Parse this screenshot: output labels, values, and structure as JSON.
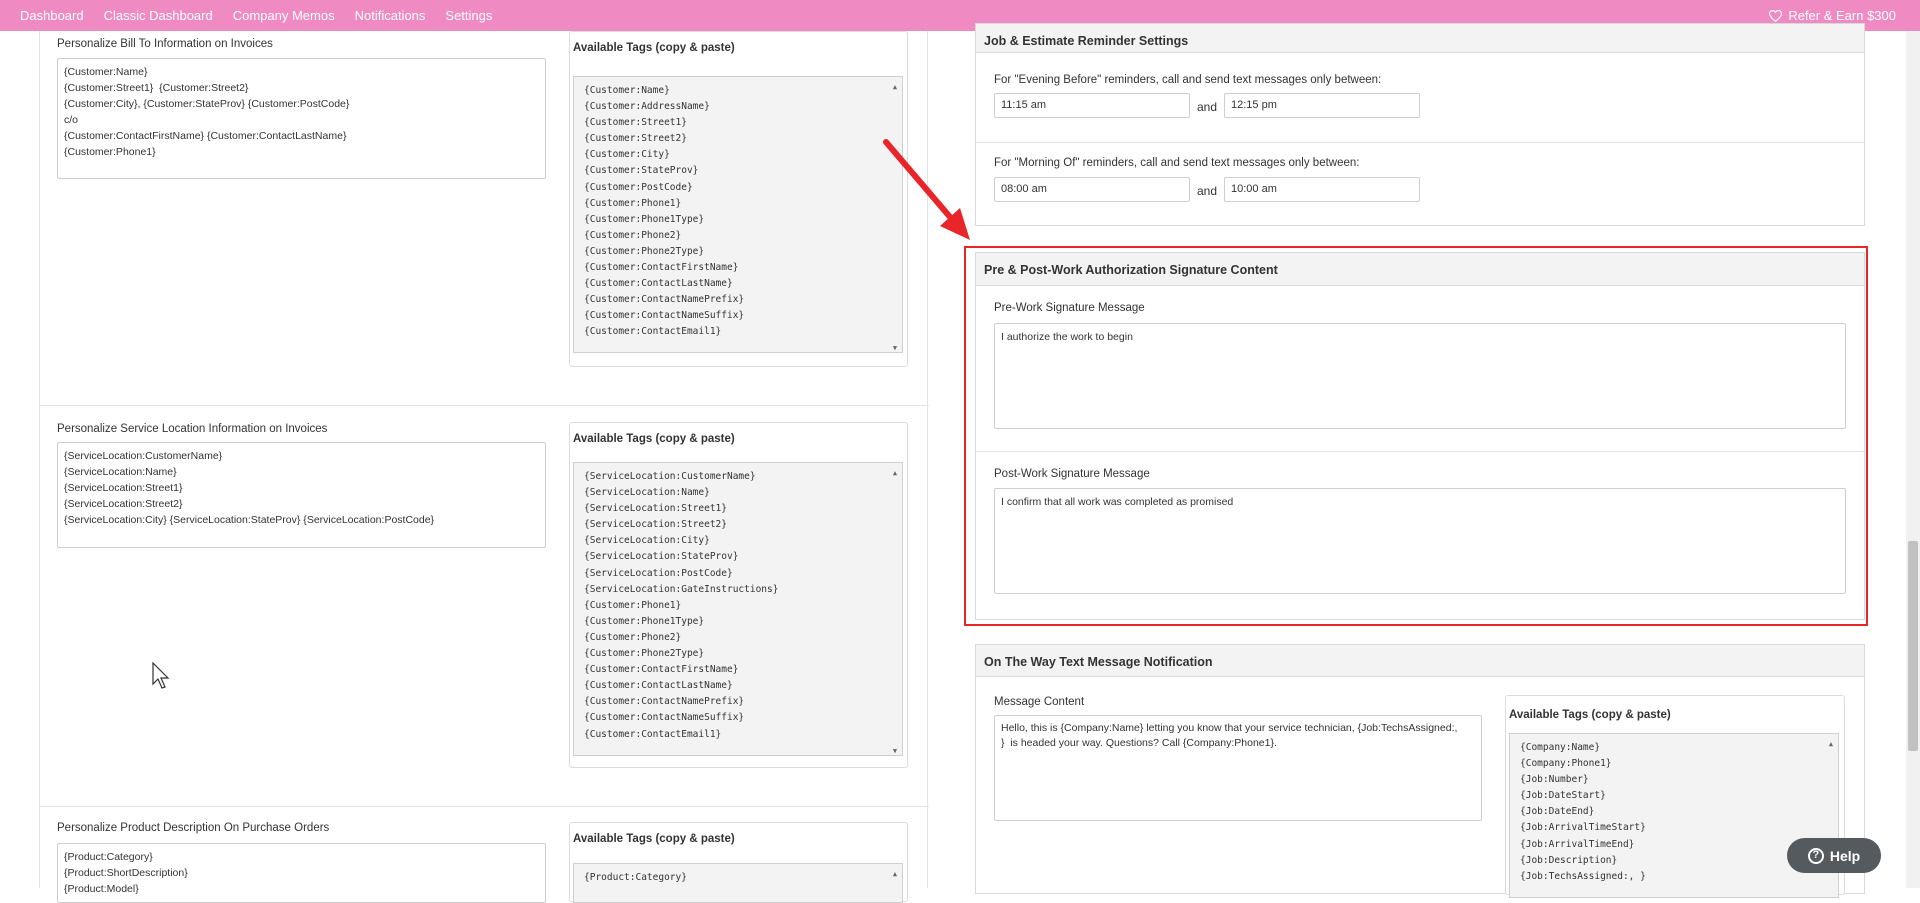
{
  "nav": {
    "items": [
      "Dashboard",
      "Classic Dashboard",
      "Company Memos",
      "Notifications",
      "Settings"
    ],
    "refer": "Refer & Earn $300"
  },
  "bill_to": {
    "label": "Personalize Bill To Information on Invoices",
    "value": "{Customer:Name}\n{Customer:Street1}  {Customer:Street2}\n{Customer:City}, {Customer:StateProv} {Customer:PostCode}\nc/o\n{Customer:ContactFirstName} {Customer:ContactLastName}\n{Customer:Phone1}",
    "tags_title": "Available Tags (copy & paste)",
    "tags": [
      "{Customer:Name}",
      "{Customer:AddressName}",
      "{Customer:Street1}",
      "{Customer:Street2}",
      "{Customer:City}",
      "{Customer:StateProv}",
      "{Customer:PostCode}",
      "{Customer:Phone1}",
      "{Customer:Phone1Type}",
      "{Customer:Phone2}",
      "{Customer:Phone2Type}",
      "{Customer:ContactFirstName}",
      "{Customer:ContactLastName}",
      "{Customer:ContactNamePrefix}",
      "{Customer:ContactNameSuffix}",
      "{Customer:ContactEmail1}"
    ]
  },
  "service_location": {
    "label": "Personalize Service Location Information on Invoices",
    "value": "{ServiceLocation:CustomerName}\n{ServiceLocation:Name}\n{ServiceLocation:Street1}\n{ServiceLocation:Street2}\n{ServiceLocation:City} {ServiceLocation:StateProv} {ServiceLocation:PostCode}",
    "tags_title": "Available Tags (copy & paste)",
    "tags": [
      "{ServiceLocation:CustomerName}",
      "{ServiceLocation:Name}",
      "{ServiceLocation:Street1}",
      "{ServiceLocation:Street2}",
      "{ServiceLocation:City}",
      "{ServiceLocation:StateProv}",
      "{ServiceLocation:PostCode}",
      "{ServiceLocation:GateInstructions}",
      "{Customer:Phone1}",
      "{Customer:Phone1Type}",
      "{Customer:Phone2}",
      "{Customer:Phone2Type}",
      "{Customer:ContactFirstName}",
      "{Customer:ContactLastName}",
      "{Customer:ContactNamePrefix}",
      "{Customer:ContactNameSuffix}",
      "{Customer:ContactEmail1}"
    ]
  },
  "product": {
    "label": "Personalize Product Description On Purchase Orders",
    "value": "{Product:Category}\n{Product:ShortDescription}\n{Product:Model}",
    "tags_title": "Available Tags (copy & paste)",
    "tags": [
      "{Product:Category}"
    ]
  },
  "reminder": {
    "title": "Job & Estimate Reminder Settings",
    "evening_label": "For \"Evening Before\" reminders, call and send text messages only between:",
    "evening_start": "11:15 am",
    "evening_end": "12:15 pm",
    "morning_label": "For \"Morning Of\" reminders, call and send text messages only between:",
    "morning_start": "08:00 am",
    "morning_end": "10:00 am",
    "and": "and"
  },
  "signature": {
    "title": "Pre & Post-Work Authorization Signature Content",
    "pre_label": "Pre-Work Signature Message",
    "pre_value": "I authorize the work to begin",
    "post_label": "Post-Work Signature Message",
    "post_value": "I confirm that all work was completed as promised"
  },
  "on_the_way": {
    "title": "On The Way Text Message Notification",
    "message_label": "Message Content",
    "message_value": "Hello, this is {Company:Name} letting you know that your service technician, {Job:TechsAssigned:,\n}  is headed your way. Questions? Call {Company:Phone1}.",
    "tags_title": "Available Tags (copy & paste)",
    "tags": [
      "{Company:Name}",
      "{Company:Phone1}",
      "{Job:Number}",
      "{Job:DateStart}",
      "{Job:DateEnd}",
      "{Job:ArrivalTimeStart}",
      "{Job:ArrivalTimeEnd}",
      "{Job:Description}",
      "{Job:TechsAssigned:, }"
    ]
  },
  "help": {
    "label": "Help"
  },
  "colors": {
    "nav": "#ef8ac2",
    "highlight": "#e8262a"
  }
}
